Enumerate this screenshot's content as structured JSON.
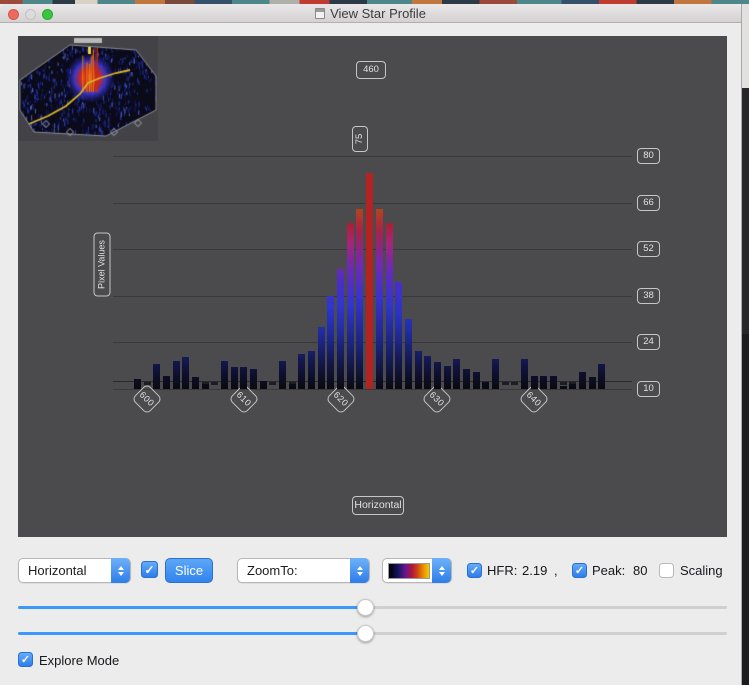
{
  "window": {
    "title": "View Star Profile"
  },
  "chart": {
    "ylabel": "Pixel Values",
    "xlabel": "Horizontal",
    "top_value_label": "460",
    "peak_value_label": "75",
    "y_ticks": [
      "80",
      "66",
      "52",
      "38",
      "24",
      "10"
    ],
    "x_ticks": [
      "600",
      "610",
      "620",
      "630",
      "640"
    ]
  },
  "chart_data": {
    "type": "bar",
    "title": "Star profile pixel values along horizontal slice",
    "xlabel": "Horizontal",
    "ylabel": "Pixel Values",
    "x": [
      599,
      600,
      601,
      602,
      603,
      604,
      605,
      606,
      607,
      608,
      609,
      610,
      611,
      612,
      613,
      614,
      615,
      616,
      617,
      618,
      619,
      620,
      621,
      622,
      623,
      624,
      625,
      626,
      627,
      628,
      629,
      630,
      631,
      632,
      633,
      634,
      635,
      636,
      637,
      638,
      639,
      640,
      641,
      642,
      643,
      644,
      645,
      646,
      647
    ],
    "values": [
      13,
      10,
      17.5,
      14,
      18.5,
      19.5,
      13.5,
      11.5,
      10,
      18.5,
      16.5,
      16.5,
      16,
      12.5,
      10,
      18.5,
      11.5,
      20.5,
      21.5,
      28.5,
      38,
      46,
      60,
      64,
      75,
      64,
      60,
      42,
      31,
      21.5,
      20,
      18,
      17,
      19,
      16,
      15,
      12,
      19,
      10,
      10,
      19,
      14,
      14,
      14,
      11,
      11.5,
      15,
      13.5,
      17.5
    ],
    "selected_x": 623,
    "selected_value": 75,
    "peak_annotation": "75",
    "top_annotation": "460",
    "xlim": [
      596,
      648
    ],
    "ylim": [
      10,
      80
    ],
    "x_tick_values": [
      600,
      610,
      620,
      630,
      640
    ],
    "y_tick_values": [
      80,
      66,
      52,
      38,
      24,
      10
    ],
    "grid": true,
    "legend": "none",
    "palette": "thermal black-blue-purple-magenta-red-orange, selected bar solid red"
  },
  "controls": {
    "slice_direction": {
      "value": "Horizontal",
      "checked": true
    },
    "slice_button_label": "Slice",
    "zoom_to": {
      "value": "ZoomTo:"
    },
    "colormap": {
      "name": "thermal-gradient"
    },
    "hfr": {
      "label": "HFR:",
      "value": "2.19",
      "checked": true
    },
    "separator": ",",
    "peak": {
      "label": "Peak:",
      "value": "80",
      "checked": true
    },
    "scaling": {
      "label": "Scaling",
      "checked": false
    },
    "explore_mode": {
      "label": "Explore Mode",
      "checked": true
    },
    "sliders": [
      {
        "percent": 49
      },
      {
        "percent": 49
      }
    ]
  },
  "colors": {
    "accent_blue": "#3b8cf0",
    "selected_bar_red": "#b42222",
    "panel_bg": "#4b4b4e",
    "gridline": "#39393d"
  }
}
